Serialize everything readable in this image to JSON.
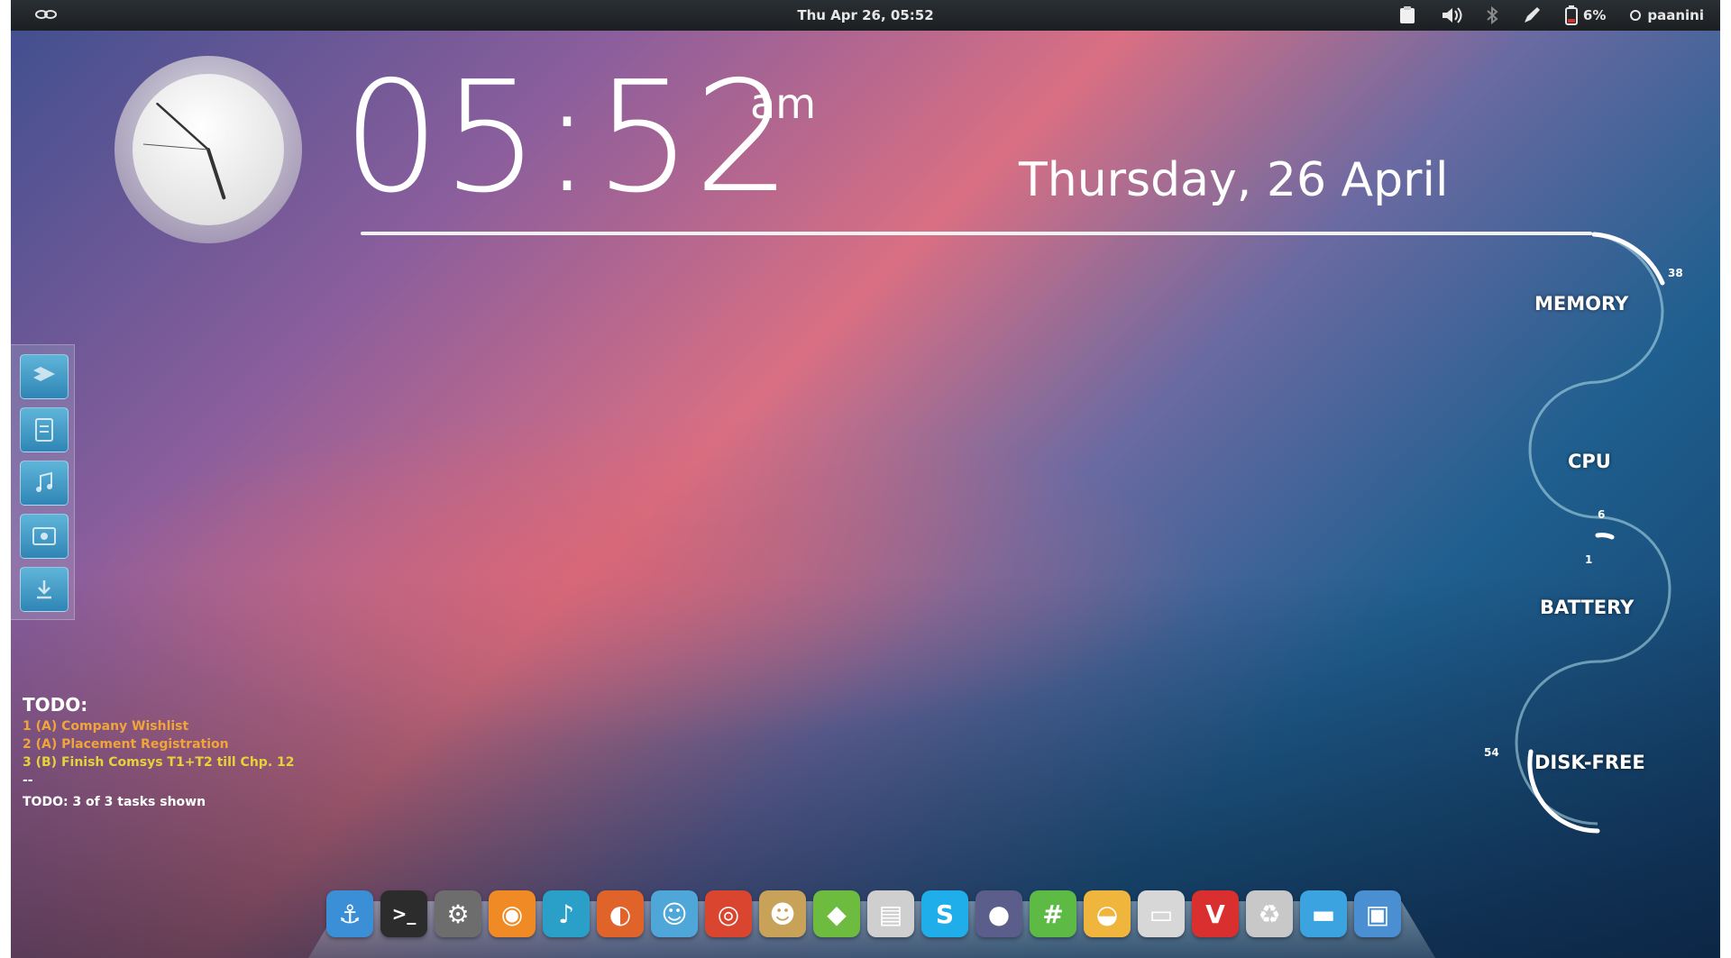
{
  "topbar": {
    "datetime": "Thu Apr 26, 05:52",
    "battery_percent": "6%",
    "username": "paanini"
  },
  "widget": {
    "time": "05:52",
    "ampm": "am",
    "date_long": "Thursday, 26 April",
    "clock_hour_angle": 162,
    "clock_minute_angle": 312
  },
  "system_monitor": {
    "memory": {
      "label": "MEMORY",
      "value": "38"
    },
    "cpu": {
      "label": "CPU",
      "value": "6"
    },
    "battery": {
      "label": "BATTERY",
      "value": "1"
    },
    "disk_free": {
      "label": "DISK-FREE",
      "value": "54"
    }
  },
  "todo": {
    "title": "TODO:",
    "items": [
      "1 (A) Company Wishlist",
      "2 (A) Placement Registration",
      "3 (B) Finish Comsys T1+T2 till Chp. 12"
    ],
    "separator": "--",
    "footer": "TODO: 3 of 3 tasks shown"
  },
  "left_shelf": [
    "dropbox-folder-icon",
    "documents-folder-icon",
    "music-folder-icon",
    "pictures-folder-icon",
    "downloads-folder-icon"
  ],
  "dock": [
    {
      "name": "anchor-icon",
      "glyph": "⚓",
      "color": "#3b8fd6"
    },
    {
      "name": "terminal-icon",
      "glyph": ">_",
      "color": "#2c2c2c"
    },
    {
      "name": "settings-app-icon",
      "glyph": "⚙",
      "color": "#6d6d6d"
    },
    {
      "name": "rss-reader-icon",
      "glyph": "◉",
      "color": "#f08a24"
    },
    {
      "name": "music-player-icon",
      "glyph": "♪",
      "color": "#2aa0c9"
    },
    {
      "name": "firefox-icon",
      "glyph": "◐",
      "color": "#e0632a"
    },
    {
      "name": "android-sdk-icon",
      "glyph": "☺",
      "color": "#4fa6d8"
    },
    {
      "name": "chrome-icon",
      "glyph": "◎",
      "color": "#d9452f"
    },
    {
      "name": "pidgin-icon",
      "glyph": "☻",
      "color": "#c9a25a"
    },
    {
      "name": "feedly-icon",
      "glyph": "◆",
      "color": "#6dbb3f"
    },
    {
      "name": "video-editor-icon",
      "glyph": "▤",
      "color": "#cfcfcf"
    },
    {
      "name": "skype-icon",
      "glyph": "S",
      "color": "#1faee9"
    },
    {
      "name": "system-monitor-icon",
      "glyph": "●",
      "color": "#5b5e8a"
    },
    {
      "name": "hashtag-app-icon",
      "glyph": "#",
      "color": "#5dbb45"
    },
    {
      "name": "store-basket-icon",
      "glyph": "◒",
      "color": "#f0b53c"
    },
    {
      "name": "drive-icon",
      "glyph": "▭",
      "color": "#d7d7d7"
    },
    {
      "name": "v-app-icon",
      "glyph": "V",
      "color": "#d92f2f"
    },
    {
      "name": "trash-icon",
      "glyph": "♻",
      "color": "#c8c8c8"
    },
    {
      "name": "files-icon",
      "glyph": "▬",
      "color": "#3ba3df"
    },
    {
      "name": "remote-desktop-icon",
      "glyph": "▣",
      "color": "#4a8fd1"
    }
  ]
}
